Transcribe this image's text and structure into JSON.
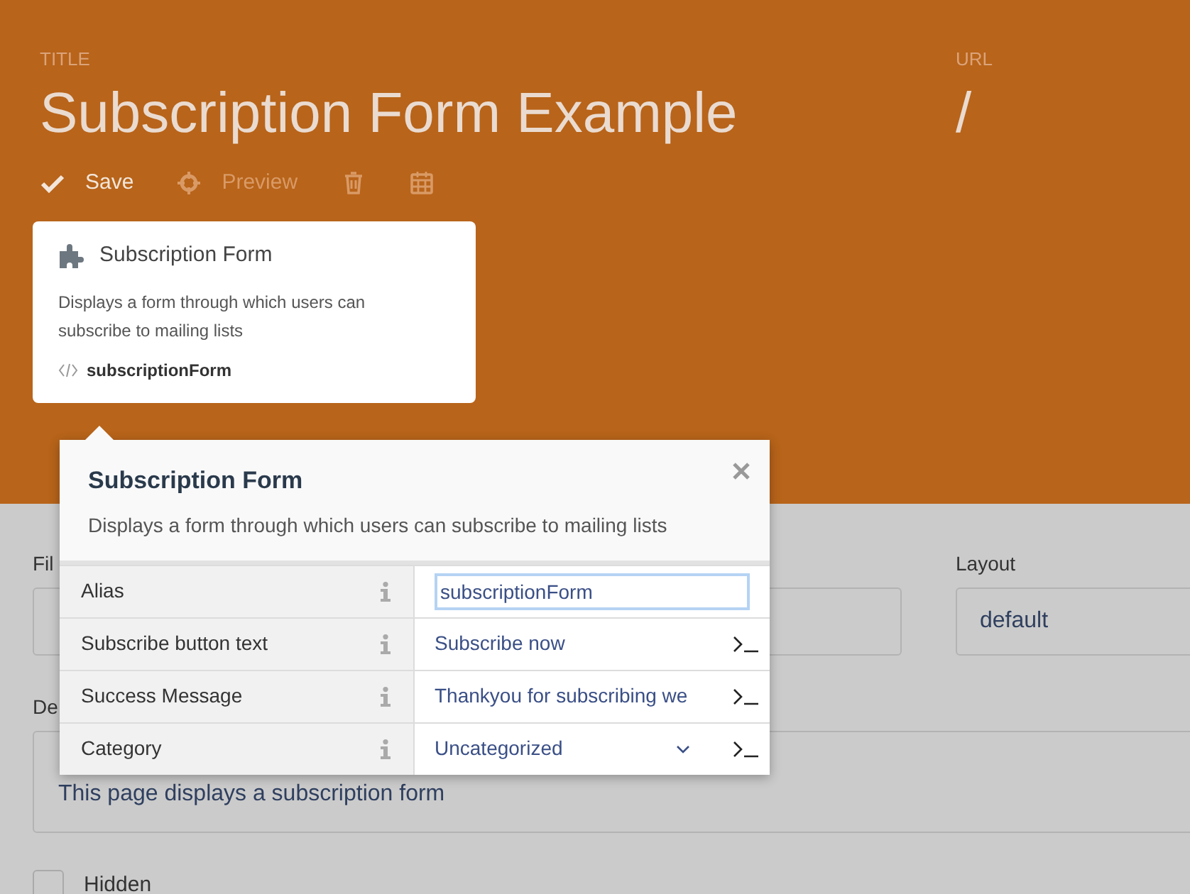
{
  "header": {
    "title_label": "TITLE",
    "title": "Subscription Form Example",
    "url_label": "URL",
    "url": "/"
  },
  "toolbar": [
    {
      "kind": "save",
      "label": "Save",
      "disabled": false
    },
    {
      "kind": "preview",
      "label": "Preview",
      "disabled": true
    },
    {
      "kind": "delete",
      "disabled": true
    },
    {
      "kind": "schedule",
      "disabled": true
    }
  ],
  "component_card": {
    "title": "Subscription Form",
    "description": "Displays a form through which users can subscribe to mailing lists",
    "alias": "subscriptionForm"
  },
  "form": {
    "file_label": "Fil",
    "layout_label": "Layout",
    "layout_value": "default",
    "description_label": "De",
    "description_value": "This page displays a subscription form",
    "hidden_label": "Hidden",
    "hidden_checked": false
  },
  "popup": {
    "title": "Subscription Form",
    "description": "Displays a form through which users can subscribe to mailing lists",
    "properties": [
      {
        "label": "Alias",
        "kind": "text",
        "value": "subscriptionForm",
        "focused": true
      },
      {
        "label": "Subscribe button text",
        "kind": "string",
        "value": "Subscribe now",
        "focused": false
      },
      {
        "label": "Success Message",
        "kind": "string",
        "value": "Thankyou for subscribing we",
        "focused": false
      },
      {
        "label": "Category",
        "kind": "dropdown",
        "value": "Uncategorized",
        "focused": false
      }
    ]
  }
}
